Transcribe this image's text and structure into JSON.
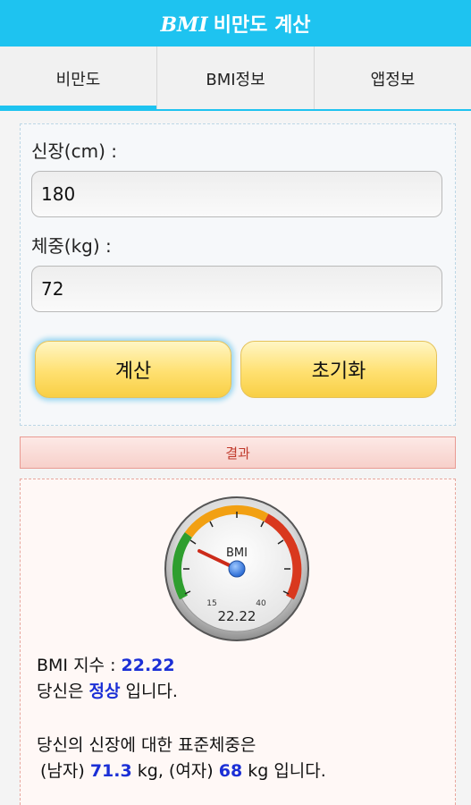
{
  "app": {
    "title_bmi": "BMI",
    "title_rest": "비만도 계산"
  },
  "tabs": [
    {
      "label": "비만도",
      "active": true
    },
    {
      "label": "BMI정보",
      "active": false
    },
    {
      "label": "앱정보",
      "active": false
    }
  ],
  "form": {
    "height_label": "신장(cm) :",
    "height_value": "180",
    "weight_label": "체중(kg) :",
    "weight_value": "72",
    "calc_label": "계산",
    "reset_label": "초기화"
  },
  "result": {
    "header": "결과",
    "gauge": {
      "label": "BMI",
      "tick_low": "15",
      "tick_high": "40",
      "value": "22.22"
    },
    "bmi_prefix": "BMI 지수 : ",
    "bmi_value": "22.22",
    "status_prefix": "당신은 ",
    "status_value": "정상",
    "status_suffix": " 입니다.",
    "std_line": "당신의 신장에 대한 표준체중은",
    "male_prefix": "(남자) ",
    "male_value": "71.3",
    "male_suffix": " kg, (여자) ",
    "female_value": "68",
    "female_suffix": " kg 입니다."
  },
  "colors": {
    "accent": "#1ec3f0",
    "value_blue": "#1b2fd6",
    "result_red": "#c0392b"
  }
}
